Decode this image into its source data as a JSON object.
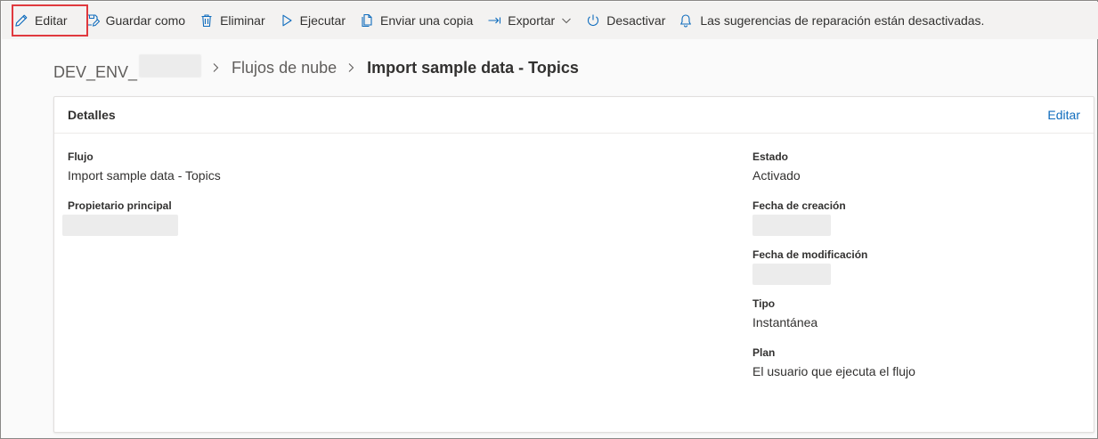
{
  "toolbar": {
    "edit_label": "Editar",
    "save_as_label": "Guardar como",
    "delete_label": "Eliminar",
    "run_label": "Ejecutar",
    "send_copy_label": "Enviar una copia",
    "export_label": "Exportar",
    "deactivate_label": "Desactivar",
    "repair_notice": "Las sugerencias de reparación están desactivadas."
  },
  "breadcrumb": {
    "environment": "DEV_ENV_",
    "section": "Flujos de nube",
    "current": "Import sample data - Topics"
  },
  "details": {
    "title": "Detalles",
    "edit_link": "Editar",
    "flow_label": "Flujo",
    "flow_value": "Import sample data - Topics",
    "owner_label": "Propietario principal",
    "status_label": "Estado",
    "status_value": "Activado",
    "created_label": "Fecha de creación",
    "modified_label": "Fecha de modificación",
    "type_label": "Tipo",
    "type_value": "Instantánea",
    "plan_label": "Plan",
    "plan_value": "El usuario que ejecuta el flujo"
  },
  "colors": {
    "accent": "#0f6cbd",
    "highlight": "#e0393e",
    "toolbar_bg": "#f3f2f1"
  }
}
